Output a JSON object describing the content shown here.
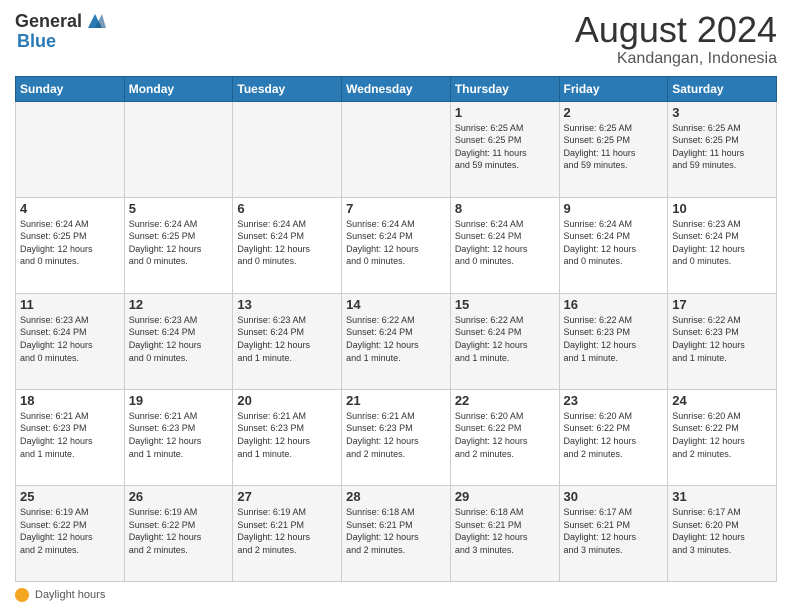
{
  "header": {
    "logo_general": "General",
    "logo_blue": "Blue",
    "main_title": "August 2024",
    "subtitle": "Kandangan, Indonesia"
  },
  "calendar": {
    "days_of_week": [
      "Sunday",
      "Monday",
      "Tuesday",
      "Wednesday",
      "Thursday",
      "Friday",
      "Saturday"
    ],
    "weeks": [
      [
        {
          "day": "",
          "info": ""
        },
        {
          "day": "",
          "info": ""
        },
        {
          "day": "",
          "info": ""
        },
        {
          "day": "",
          "info": ""
        },
        {
          "day": "1",
          "info": "Sunrise: 6:25 AM\nSunset: 6:25 PM\nDaylight: 11 hours\nand 59 minutes."
        },
        {
          "day": "2",
          "info": "Sunrise: 6:25 AM\nSunset: 6:25 PM\nDaylight: 11 hours\nand 59 minutes."
        },
        {
          "day": "3",
          "info": "Sunrise: 6:25 AM\nSunset: 6:25 PM\nDaylight: 11 hours\nand 59 minutes."
        }
      ],
      [
        {
          "day": "4",
          "info": "Sunrise: 6:24 AM\nSunset: 6:25 PM\nDaylight: 12 hours\nand 0 minutes."
        },
        {
          "day": "5",
          "info": "Sunrise: 6:24 AM\nSunset: 6:25 PM\nDaylight: 12 hours\nand 0 minutes."
        },
        {
          "day": "6",
          "info": "Sunrise: 6:24 AM\nSunset: 6:24 PM\nDaylight: 12 hours\nand 0 minutes."
        },
        {
          "day": "7",
          "info": "Sunrise: 6:24 AM\nSunset: 6:24 PM\nDaylight: 12 hours\nand 0 minutes."
        },
        {
          "day": "8",
          "info": "Sunrise: 6:24 AM\nSunset: 6:24 PM\nDaylight: 12 hours\nand 0 minutes."
        },
        {
          "day": "9",
          "info": "Sunrise: 6:24 AM\nSunset: 6:24 PM\nDaylight: 12 hours\nand 0 minutes."
        },
        {
          "day": "10",
          "info": "Sunrise: 6:23 AM\nSunset: 6:24 PM\nDaylight: 12 hours\nand 0 minutes."
        }
      ],
      [
        {
          "day": "11",
          "info": "Sunrise: 6:23 AM\nSunset: 6:24 PM\nDaylight: 12 hours\nand 0 minutes."
        },
        {
          "day": "12",
          "info": "Sunrise: 6:23 AM\nSunset: 6:24 PM\nDaylight: 12 hours\nand 0 minutes."
        },
        {
          "day": "13",
          "info": "Sunrise: 6:23 AM\nSunset: 6:24 PM\nDaylight: 12 hours\nand 1 minute."
        },
        {
          "day": "14",
          "info": "Sunrise: 6:22 AM\nSunset: 6:24 PM\nDaylight: 12 hours\nand 1 minute."
        },
        {
          "day": "15",
          "info": "Sunrise: 6:22 AM\nSunset: 6:24 PM\nDaylight: 12 hours\nand 1 minute."
        },
        {
          "day": "16",
          "info": "Sunrise: 6:22 AM\nSunset: 6:23 PM\nDaylight: 12 hours\nand 1 minute."
        },
        {
          "day": "17",
          "info": "Sunrise: 6:22 AM\nSunset: 6:23 PM\nDaylight: 12 hours\nand 1 minute."
        }
      ],
      [
        {
          "day": "18",
          "info": "Sunrise: 6:21 AM\nSunset: 6:23 PM\nDaylight: 12 hours\nand 1 minute."
        },
        {
          "day": "19",
          "info": "Sunrise: 6:21 AM\nSunset: 6:23 PM\nDaylight: 12 hours\nand 1 minute."
        },
        {
          "day": "20",
          "info": "Sunrise: 6:21 AM\nSunset: 6:23 PM\nDaylight: 12 hours\nand 1 minute."
        },
        {
          "day": "21",
          "info": "Sunrise: 6:21 AM\nSunset: 6:23 PM\nDaylight: 12 hours\nand 2 minutes."
        },
        {
          "day": "22",
          "info": "Sunrise: 6:20 AM\nSunset: 6:22 PM\nDaylight: 12 hours\nand 2 minutes."
        },
        {
          "day": "23",
          "info": "Sunrise: 6:20 AM\nSunset: 6:22 PM\nDaylight: 12 hours\nand 2 minutes."
        },
        {
          "day": "24",
          "info": "Sunrise: 6:20 AM\nSunset: 6:22 PM\nDaylight: 12 hours\nand 2 minutes."
        }
      ],
      [
        {
          "day": "25",
          "info": "Sunrise: 6:19 AM\nSunset: 6:22 PM\nDaylight: 12 hours\nand 2 minutes."
        },
        {
          "day": "26",
          "info": "Sunrise: 6:19 AM\nSunset: 6:22 PM\nDaylight: 12 hours\nand 2 minutes."
        },
        {
          "day": "27",
          "info": "Sunrise: 6:19 AM\nSunset: 6:21 PM\nDaylight: 12 hours\nand 2 minutes."
        },
        {
          "day": "28",
          "info": "Sunrise: 6:18 AM\nSunset: 6:21 PM\nDaylight: 12 hours\nand 2 minutes."
        },
        {
          "day": "29",
          "info": "Sunrise: 6:18 AM\nSunset: 6:21 PM\nDaylight: 12 hours\nand 3 minutes."
        },
        {
          "day": "30",
          "info": "Sunrise: 6:17 AM\nSunset: 6:21 PM\nDaylight: 12 hours\nand 3 minutes."
        },
        {
          "day": "31",
          "info": "Sunrise: 6:17 AM\nSunset: 6:20 PM\nDaylight: 12 hours\nand 3 minutes."
        }
      ]
    ]
  },
  "footer": {
    "daylight_label": "Daylight hours"
  }
}
